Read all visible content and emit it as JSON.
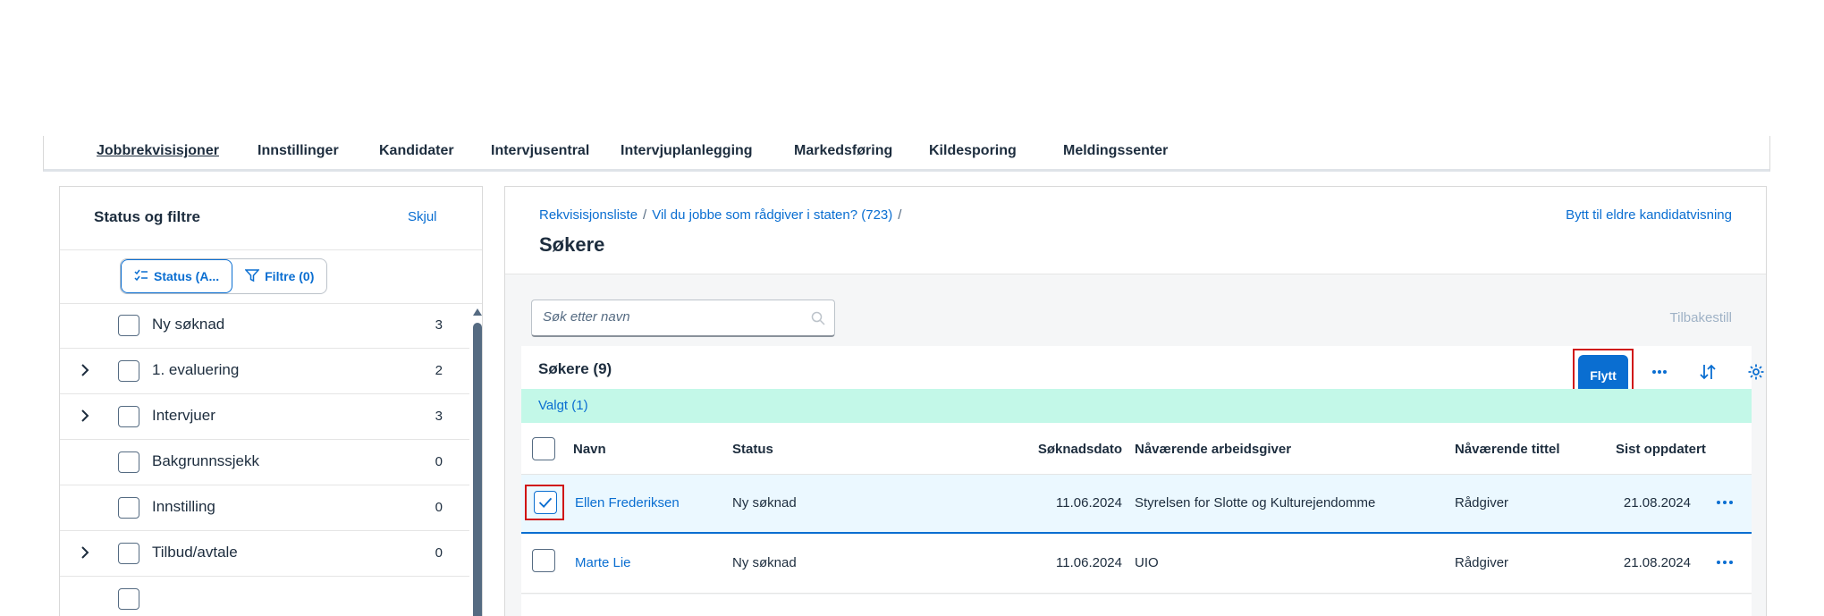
{
  "nav": {
    "tabs": [
      {
        "label": "Jobbrekvisisjoner",
        "active": true
      },
      {
        "label": "Innstillinger"
      },
      {
        "label": "Kandidater"
      },
      {
        "label": "Intervjusentral"
      },
      {
        "label": "Intervjuplanlegging"
      },
      {
        "label": "Markedsføring"
      },
      {
        "label": "Kildesporing"
      },
      {
        "label": "Meldingssenter"
      }
    ]
  },
  "filters_panel": {
    "title": "Status og filtre",
    "hide_label": "Skjul",
    "segments": {
      "status_label": "Status (A...",
      "filters_label": "Filtre (0)"
    },
    "statuses": [
      {
        "label": "Ny søknad",
        "count": "3",
        "expandable": false
      },
      {
        "label": "1. evaluering",
        "count": "2",
        "expandable": true
      },
      {
        "label": "Intervjuer",
        "count": "3",
        "expandable": true
      },
      {
        "label": "Bakgrunnssjekk",
        "count": "0",
        "expandable": false
      },
      {
        "label": "Innstilling",
        "count": "0",
        "expandable": false
      },
      {
        "label": "Tilbud/avtale",
        "count": "0",
        "expandable": true
      }
    ]
  },
  "main": {
    "breadcrumb": {
      "item1": "Rekvisisjonsliste",
      "item2": "Vil du jobbe som rådgiver i staten? (723)",
      "separator": "/"
    },
    "title": "Søkere",
    "legacy_view_link": "Bytt til eldre kandidatvisning",
    "search": {
      "placeholder": "Søk etter navn",
      "value": ""
    },
    "reset_label": "Tilbakestill",
    "table": {
      "title": "Søkere (9)",
      "move_label": "Flytt",
      "selected_label": "Valgt (1)",
      "columns": {
        "name": "Navn",
        "status": "Status",
        "date": "Søknadsdato",
        "employer": "Nåværende arbeidsgiver",
        "jobtitle": "Nåværende tittel",
        "updated": "Sist oppdatert"
      },
      "rows": [
        {
          "name": "Ellen Frederiksen",
          "status": "Ny søknad",
          "date": "11.06.2024",
          "employer": "Styrelsen for Slotte og Kulturejendomme",
          "jobtitle": "Rådgiver",
          "updated": "21.08.2024",
          "selected": true
        },
        {
          "name": "Marte Lie",
          "status": "Ny søknad",
          "date": "11.06.2024",
          "employer": "UIO",
          "jobtitle": "Rådgiver",
          "updated": "21.08.2024",
          "selected": false
        }
      ]
    }
  },
  "colors": {
    "accent": "#0a6ed1",
    "text": "#1d2d3e",
    "selected_bar": "#c3f8e8",
    "highlight_border": "#d01515"
  }
}
